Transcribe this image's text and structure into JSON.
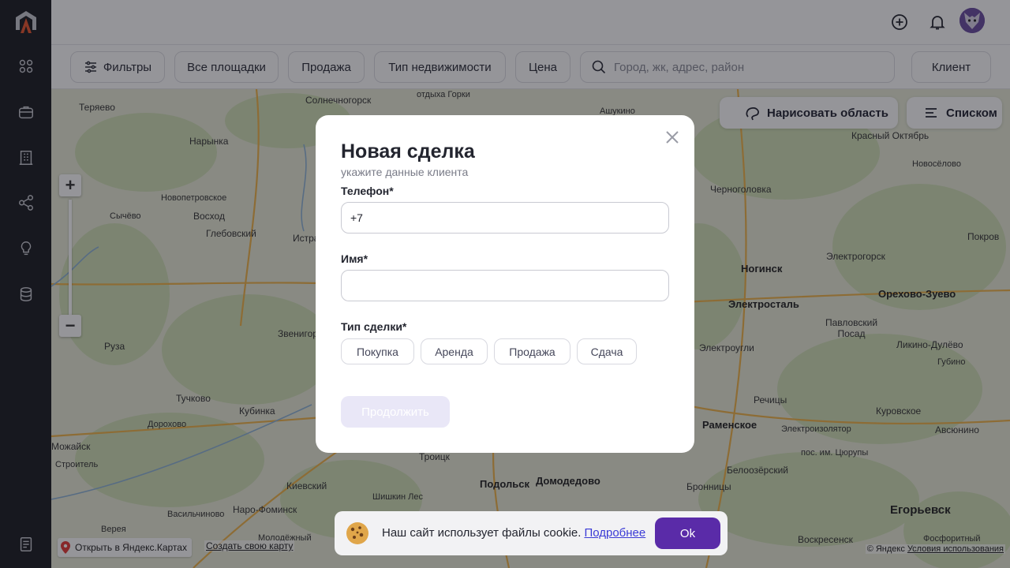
{
  "header": {
    "add_icon": "plus-circle-icon",
    "bell_icon": "bell-icon"
  },
  "sidebar": {
    "items": [
      "grid-icon",
      "briefcase-icon",
      "building-icon",
      "share-icon",
      "lightbulb-icon",
      "database-icon",
      "document-icon"
    ]
  },
  "filters": {
    "filters_label": "Фильтры",
    "all_sites": "Все площадки",
    "sale": "Продажа",
    "property_type": "Тип недвижимости",
    "price": "Цена",
    "search_placeholder": "Город, жк, адрес, район",
    "client": "Клиент"
  },
  "map": {
    "draw_area": "Нарисовать область",
    "list_view": "Списком",
    "open_yandex": "Открыть в Яндекс.Картах",
    "create_map": "Создать свою карту",
    "copyright": "© Яндекс",
    "terms": "Условия использования",
    "towns": [
      "Теряево",
      "Солнечногорск",
      "отдыха Горки",
      "Ашукино",
      "Красный Октябрь",
      "Новосёлово",
      "Нарынка",
      "Новопетровское",
      "Восход",
      "Сычёво",
      "Глебовский",
      "Истра",
      "Черноголовка",
      "Ногинск",
      "Электрогорск",
      "Покров",
      "Электросталь",
      "Орехово-Зуево",
      "Павловский Посад",
      "Ликино-Дулёво",
      "Губино",
      "Звенигород",
      "Руза",
      "Электроугли",
      "Тучково",
      "Кубинка",
      "Дорохово",
      "Можайск",
      "Строитель",
      "Речицы",
      "Раменское",
      "Электроизолятор",
      "Куровское",
      "Авсюнино",
      "пос. им. Цюрупы",
      "Белоозёрский",
      "Троицк",
      "Подольск",
      "Домодедово",
      "Бронницы",
      "Киевский",
      "Шишкин Лес",
      "Наро-Фоминск",
      "Васильчиново",
      "Верея",
      "Молодёжный",
      "Егорьевск",
      "Воскресенск",
      "Фосфоритный"
    ]
  },
  "modal": {
    "title": "Новая сделка",
    "subtitle": "укажите данные клиента",
    "phone_label": "Телефон*",
    "phone_value": "+7",
    "name_label": "Имя*",
    "name_value": "",
    "deal_type_label": "Тип сделки*",
    "deal_types": [
      "Покупка",
      "Аренда",
      "Продажа",
      "Сдача"
    ],
    "continue_label": "Продолжить"
  },
  "cookie": {
    "text": "Наш сайт использует файлы cookie.",
    "more": "Подробнее",
    "ok": "Ok"
  },
  "colors": {
    "accent": "#5a2ba8",
    "sidebar": "#1b1c22",
    "logo_orange": "#e8542c"
  }
}
